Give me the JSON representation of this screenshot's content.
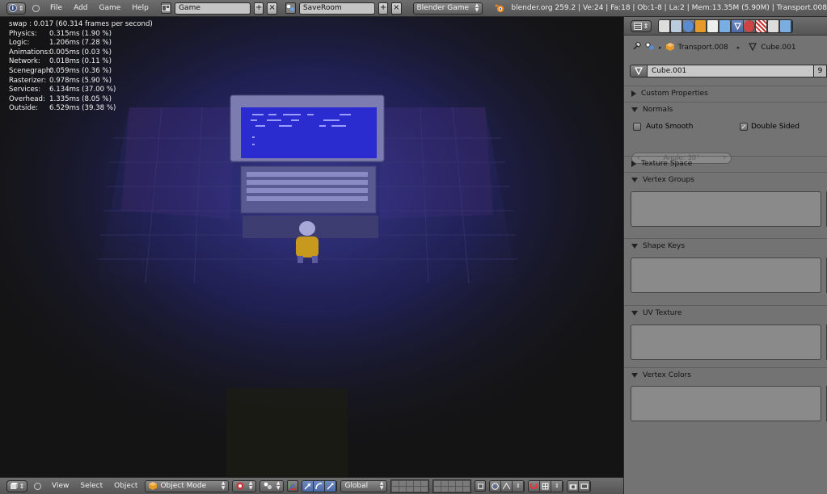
{
  "topbar": {
    "menus": [
      "File",
      "Add",
      "Game",
      "Help"
    ],
    "screen_layout": "Game",
    "scene": "SaveRoom",
    "engine": "Blender Game",
    "stats": "blender.org 259.2 | Ve:24 | Fa:18 | Ob:1-8 | La:2 | Mem:13.35M (5.90M) | Transport.008"
  },
  "profiler": {
    "swap": "swap : 0.017 (60.314 frames per second)",
    "rows": [
      {
        "label": "Physics:",
        "value": "0.315ms (1.90 %)"
      },
      {
        "label": "Logic:",
        "value": "1.206ms (7.28 %)"
      },
      {
        "label": "Animations:",
        "value": "0.005ms (0.03 %)"
      },
      {
        "label": "Network:",
        "value": "0.018ms (0.11 %)"
      },
      {
        "label": "Scenegraph:",
        "value": "0.059ms (0.36 %)"
      },
      {
        "label": "Rasterizer:",
        "value": "0.978ms (5.90 %)"
      },
      {
        "label": "Services:",
        "value": "6.134ms (37.00 %)"
      },
      {
        "label": "Overhead:",
        "value": "1.335ms (8.05 %)"
      },
      {
        "label": "Outside:",
        "value": "6.529ms (39.38 %)"
      }
    ]
  },
  "bottombar": {
    "menus": [
      "View",
      "Select",
      "Object"
    ],
    "mode": "Object Mode",
    "orientation": "Global"
  },
  "properties": {
    "breadcrumb": {
      "object": "Transport.008",
      "mesh": "Cube.001"
    },
    "mesh_name": "Cube.001",
    "mesh_users": "9",
    "panels": {
      "custom_properties": "Custom Properties",
      "normals": "Normals",
      "auto_smooth": "Auto Smooth",
      "double_sided": "Double Sided",
      "angle": "Angle: 30°",
      "texture_space": "Texture Space",
      "vertex_groups": "Vertex Groups",
      "shape_keys": "Shape Keys",
      "uv_texture": "UV Texture",
      "vertex_colors": "Vertex Colors"
    }
  },
  "colors": {
    "screen_blue": "#2a2cd0",
    "panel_bg": "#737373",
    "header_bg": "#5e5e5e"
  }
}
